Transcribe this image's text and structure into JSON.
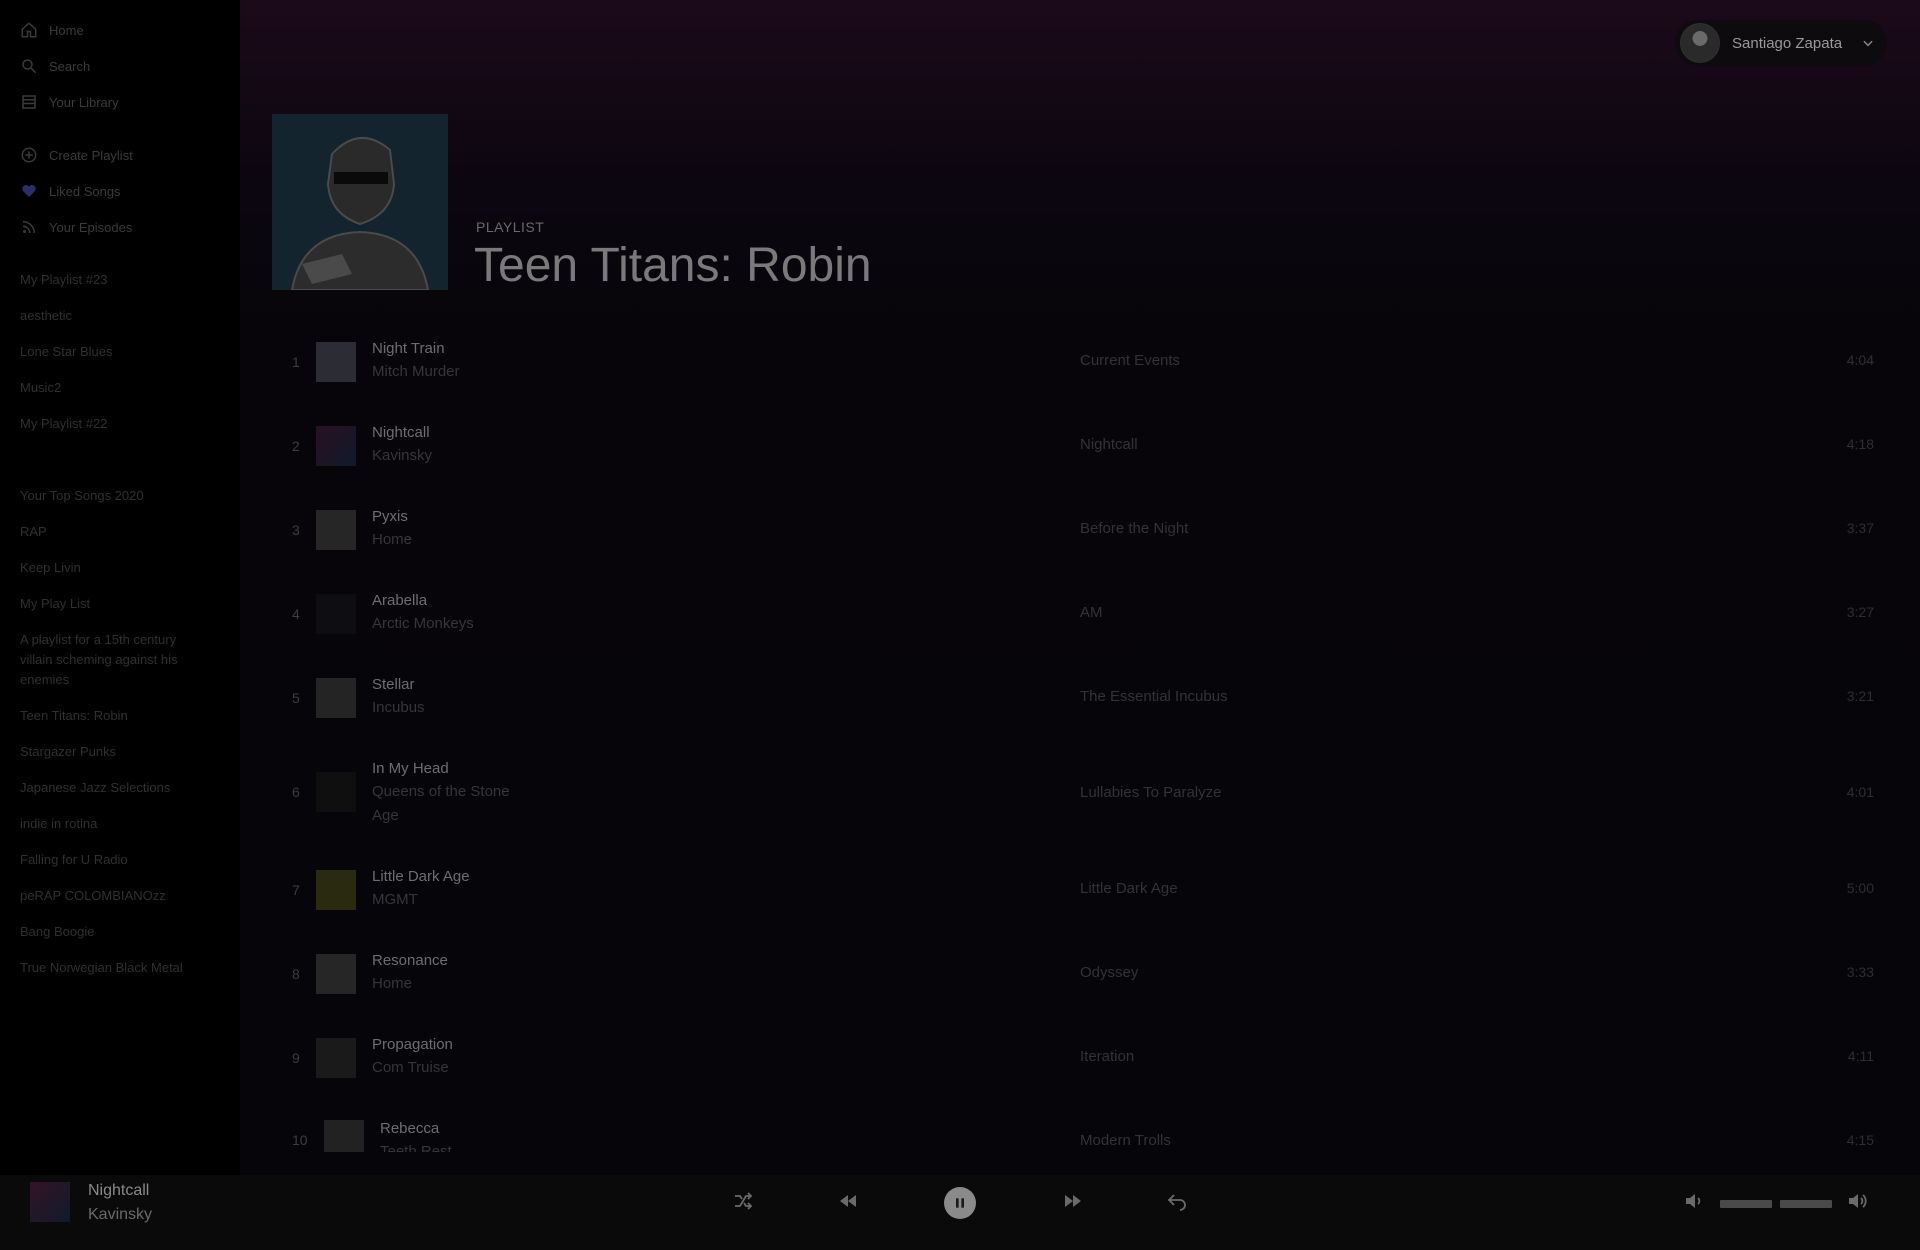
{
  "sidebar": {
    "nav": [
      "Home",
      "Search",
      "Your Library"
    ],
    "actions": [
      "Create Playlist",
      "Liked Songs",
      "Your Episodes"
    ],
    "playlists": [
      "My Playlist #23",
      "aesthetic",
      "Lone Star Blues",
      "Music2",
      "My Playlist #22",
      "",
      "Your Top Songs 2020",
      "RAP",
      "Keep Livin",
      "My Play List",
      "A playlist for a 15th century villain scheming against his enemies",
      "Teen Titans: Robin",
      "Stargazer Punks",
      "Japanese Jazz Selections",
      "indie in rotina",
      "Falling for U Radio",
      "peRAP COLOMBIANOzz",
      "Bang Boogie",
      "True Norwegian Black Metal"
    ]
  },
  "user": {
    "name": "Santiago Zapata"
  },
  "playlist": {
    "label": "PLAYLIST",
    "title": "Teen Titans: Robin"
  },
  "tracks": [
    {
      "num": "1",
      "title": "Night Train",
      "artist": "Mitch Murder",
      "album": "Current Events",
      "duration": "4:04"
    },
    {
      "num": "2",
      "title": "Nightcall",
      "artist": "Kavinsky",
      "album": "Nightcall",
      "duration": "4:18"
    },
    {
      "num": "3",
      "title": "Pyxis",
      "artist": "Home",
      "album": "Before the Night",
      "duration": "3:37"
    },
    {
      "num": "4",
      "title": "Arabella",
      "artist": "Arctic Monkeys",
      "album": "AM",
      "duration": "3:27"
    },
    {
      "num": "5",
      "title": "Stellar",
      "artist": "Incubus",
      "album": "The Essential Incubus",
      "duration": "3:21"
    },
    {
      "num": "6",
      "title": "In My Head",
      "artist": "Queens of the Stone Age",
      "album": "Lullabies To Paralyze",
      "duration": "4:01"
    },
    {
      "num": "7",
      "title": "Little Dark Age",
      "artist": "MGMT",
      "album": "Little Dark Age",
      "duration": "5:00"
    },
    {
      "num": "8",
      "title": "Resonance",
      "artist": "Home",
      "album": "Odyssey",
      "duration": "3:33"
    },
    {
      "num": "9",
      "title": "Propagation",
      "artist": "Com Truise",
      "album": "Iteration",
      "duration": "4:11"
    },
    {
      "num": "10",
      "title": "Rebecca",
      "artist": "Teeth Rest",
      "album": "Modern Trolls",
      "duration": "4:15"
    }
  ],
  "now_playing": {
    "title": "Nightcall",
    "artist": "Kavinsky"
  },
  "player": {
    "volume": 0.5
  },
  "colors": {
    "background": "#050406",
    "header_tint": "#1c0a1a"
  }
}
